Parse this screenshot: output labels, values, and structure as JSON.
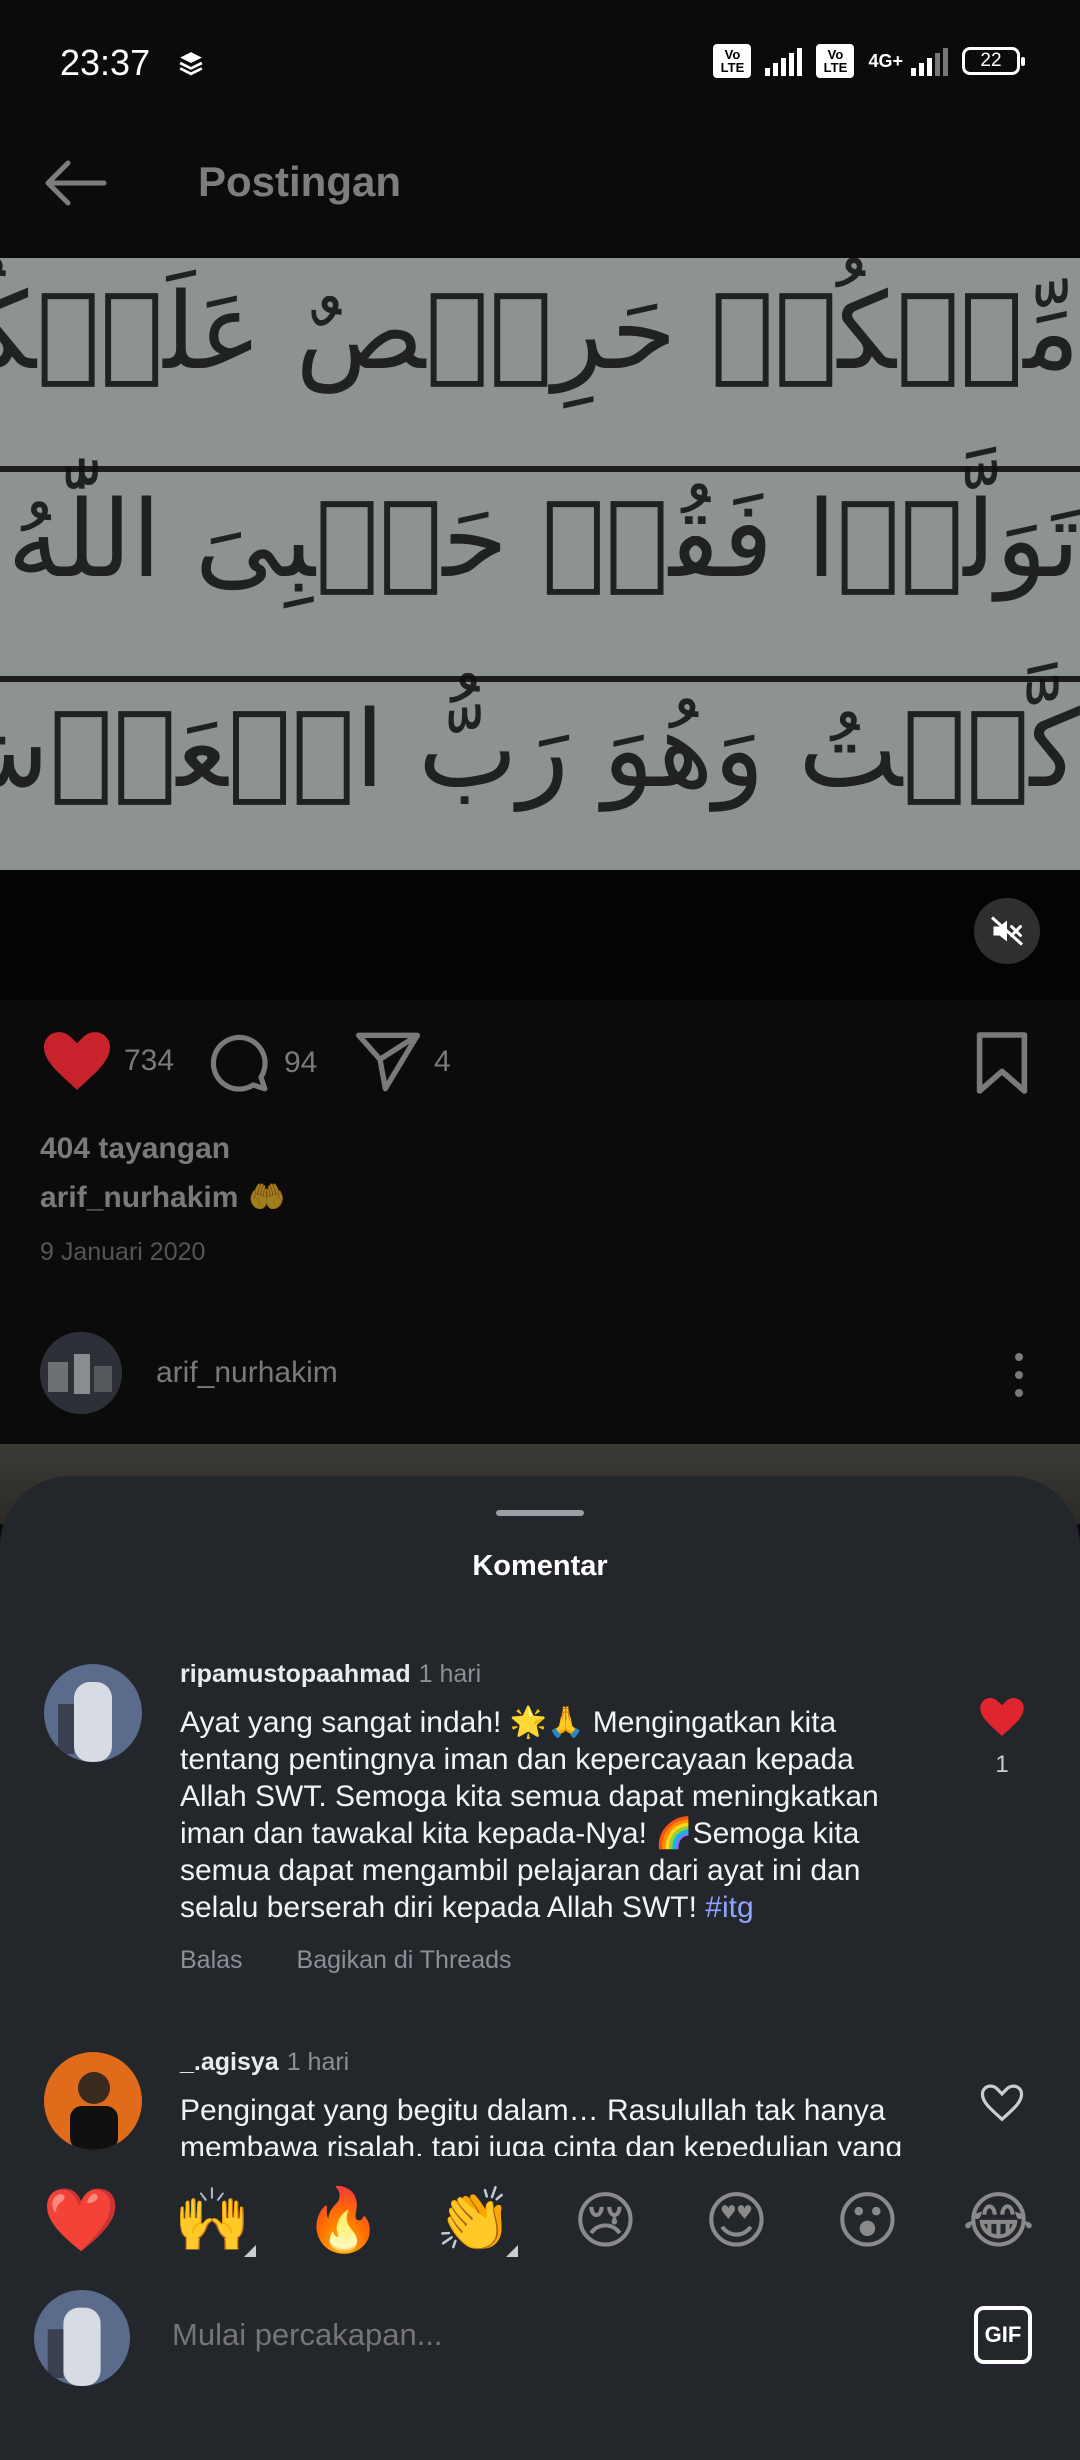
{
  "status_bar": {
    "time": "23:37",
    "volte1": "Vo LTE",
    "volte2": "Vo LTE",
    "network": "4G+",
    "battery": "22"
  },
  "header": {
    "title": "Postingan"
  },
  "post": {
    "image_text_lines": [
      "مِّنۡكُمۡ حَرِيۡصٌ عَلَيۡكُمۡ بِالۡمُؤۡمِنِيۡ",
      "تَوَلَّوۡا فَقُلۡ حَسۡبِىَ اللّٰهُ ۖ لَاۤ اِلٰ",
      "كَّلۡتُ وَهُوَ رَبُّ الۡعَرۡشِ الۡ"
    ],
    "likes": "734",
    "comments": "94",
    "shares": "4",
    "views": "404 tayangan",
    "caption_user": "arif_nurhakim",
    "caption_emoji": "🤲",
    "date": "9 Januari 2020",
    "author": "arif_nurhakim"
  },
  "sheet": {
    "title": "Komentar",
    "comments": [
      {
        "user": "ripamustopaahmad",
        "time": "1 hari",
        "text": "Ayat yang sangat indah! 🌟🙏 Mengingatkan kita tentang pentingnya iman dan kepercayaan kepada Allah SWT. Semoga kita semua dapat meningkatkan iman dan tawakal kita kepada-Nya! 🌈Semoga kita semua dapat mengambil pelajaran dari ayat ini dan selalu berserah diri kepada Allah SWT! ",
        "tag": "#itg",
        "reply": "Balas",
        "share": "Bagikan di Threads",
        "likes": "1"
      },
      {
        "user": "_.agisya",
        "time": "1 hari",
        "text": "Pengingat yang begitu dalam… Rasulullah tak hanya membawa risalah, tapi juga cinta dan kepedulian yang"
      }
    ]
  },
  "emoji_bar": [
    "❤️",
    "🙌",
    "🔥",
    "👏",
    "😢",
    "😍",
    "😮",
    "😂"
  ],
  "composer": {
    "placeholder": "Mulai percakapan...",
    "gif_label": "GIF"
  },
  "colors": {
    "like_red": "#e0252e",
    "sheet_bg": "#23262b",
    "hashtag": "#8ea2ff"
  }
}
